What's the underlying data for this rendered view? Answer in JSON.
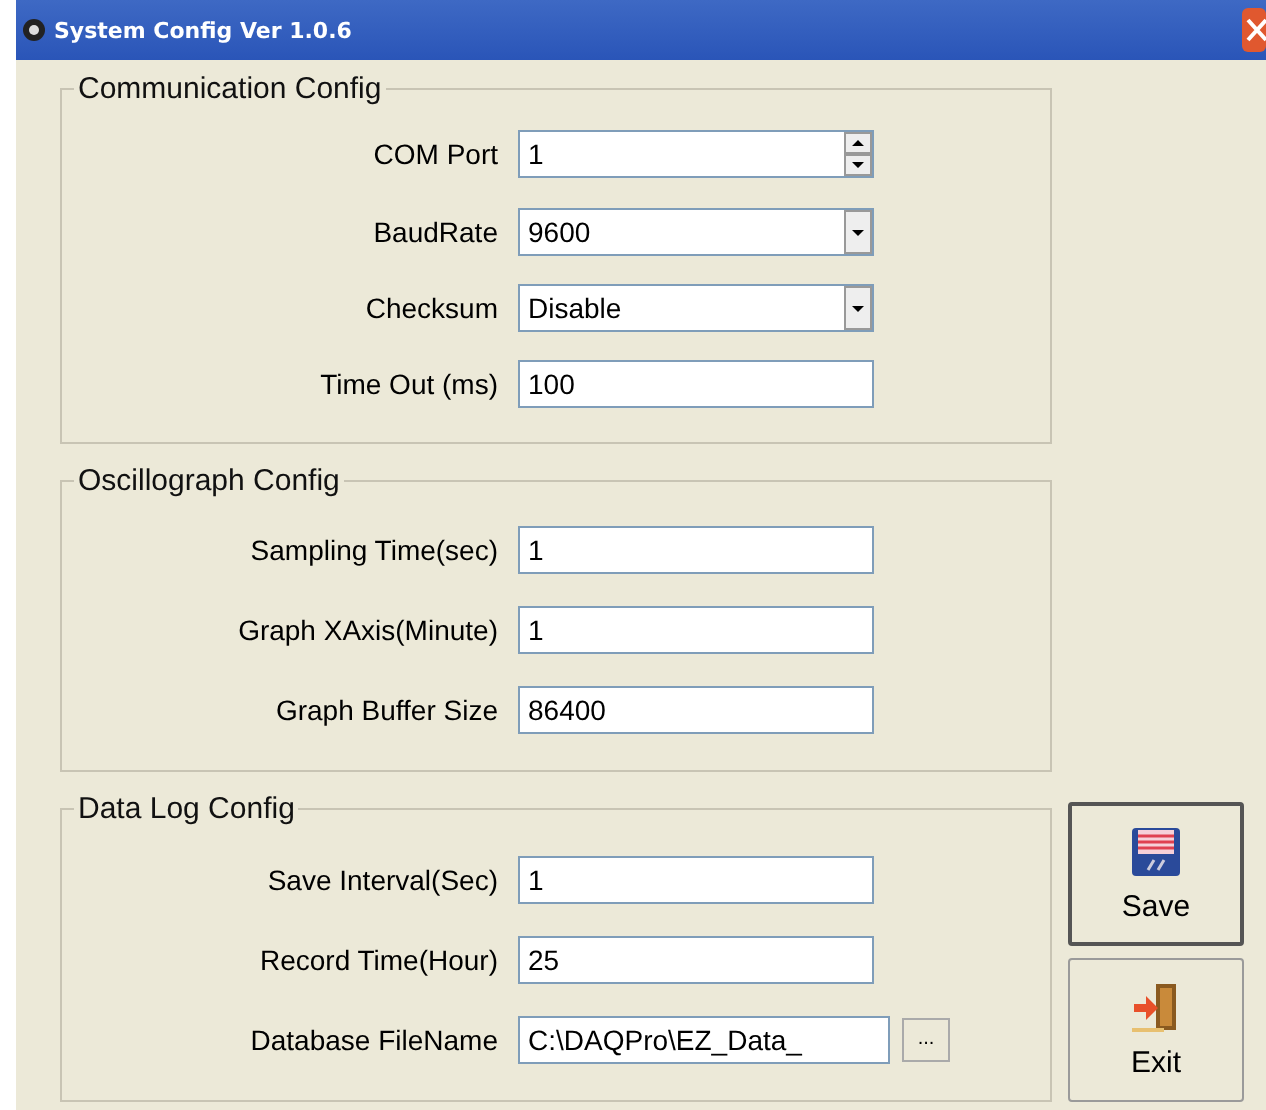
{
  "window": {
    "title": "System Config Ver 1.0.6"
  },
  "groups": [
    {
      "title": "Communication Config",
      "fields": [
        {
          "label": "COM Port",
          "value": "1",
          "kind": "spin"
        },
        {
          "label": "BaudRate",
          "value": "9600",
          "kind": "dropdown"
        },
        {
          "label": "Checksum",
          "value": "Disable",
          "kind": "dropdown"
        },
        {
          "label": "Time Out (ms)",
          "value": "100",
          "kind": "text"
        }
      ]
    },
    {
      "title": "Oscillograph Config",
      "fields": [
        {
          "label": "Sampling Time(sec)",
          "value": "1",
          "kind": "text"
        },
        {
          "label": "Graph XAxis(Minute)",
          "value": "1",
          "kind": "text"
        },
        {
          "label": "Graph Buffer Size",
          "value": "86400",
          "kind": "text"
        }
      ]
    },
    {
      "title": "Data Log Config",
      "fields": [
        {
          "label": "Save Interval(Sec)",
          "value": "1",
          "kind": "text"
        },
        {
          "label": "Record Time(Hour)",
          "value": "25",
          "kind": "text"
        },
        {
          "label": "Database FileName",
          "value": "C:\\DAQPro\\EZ_Data_",
          "kind": "browse",
          "browse_label": "..."
        }
      ]
    }
  ],
  "buttons": [
    {
      "label": "Save",
      "kind": "save"
    },
    {
      "label": "Exit",
      "kind": "exit"
    }
  ]
}
